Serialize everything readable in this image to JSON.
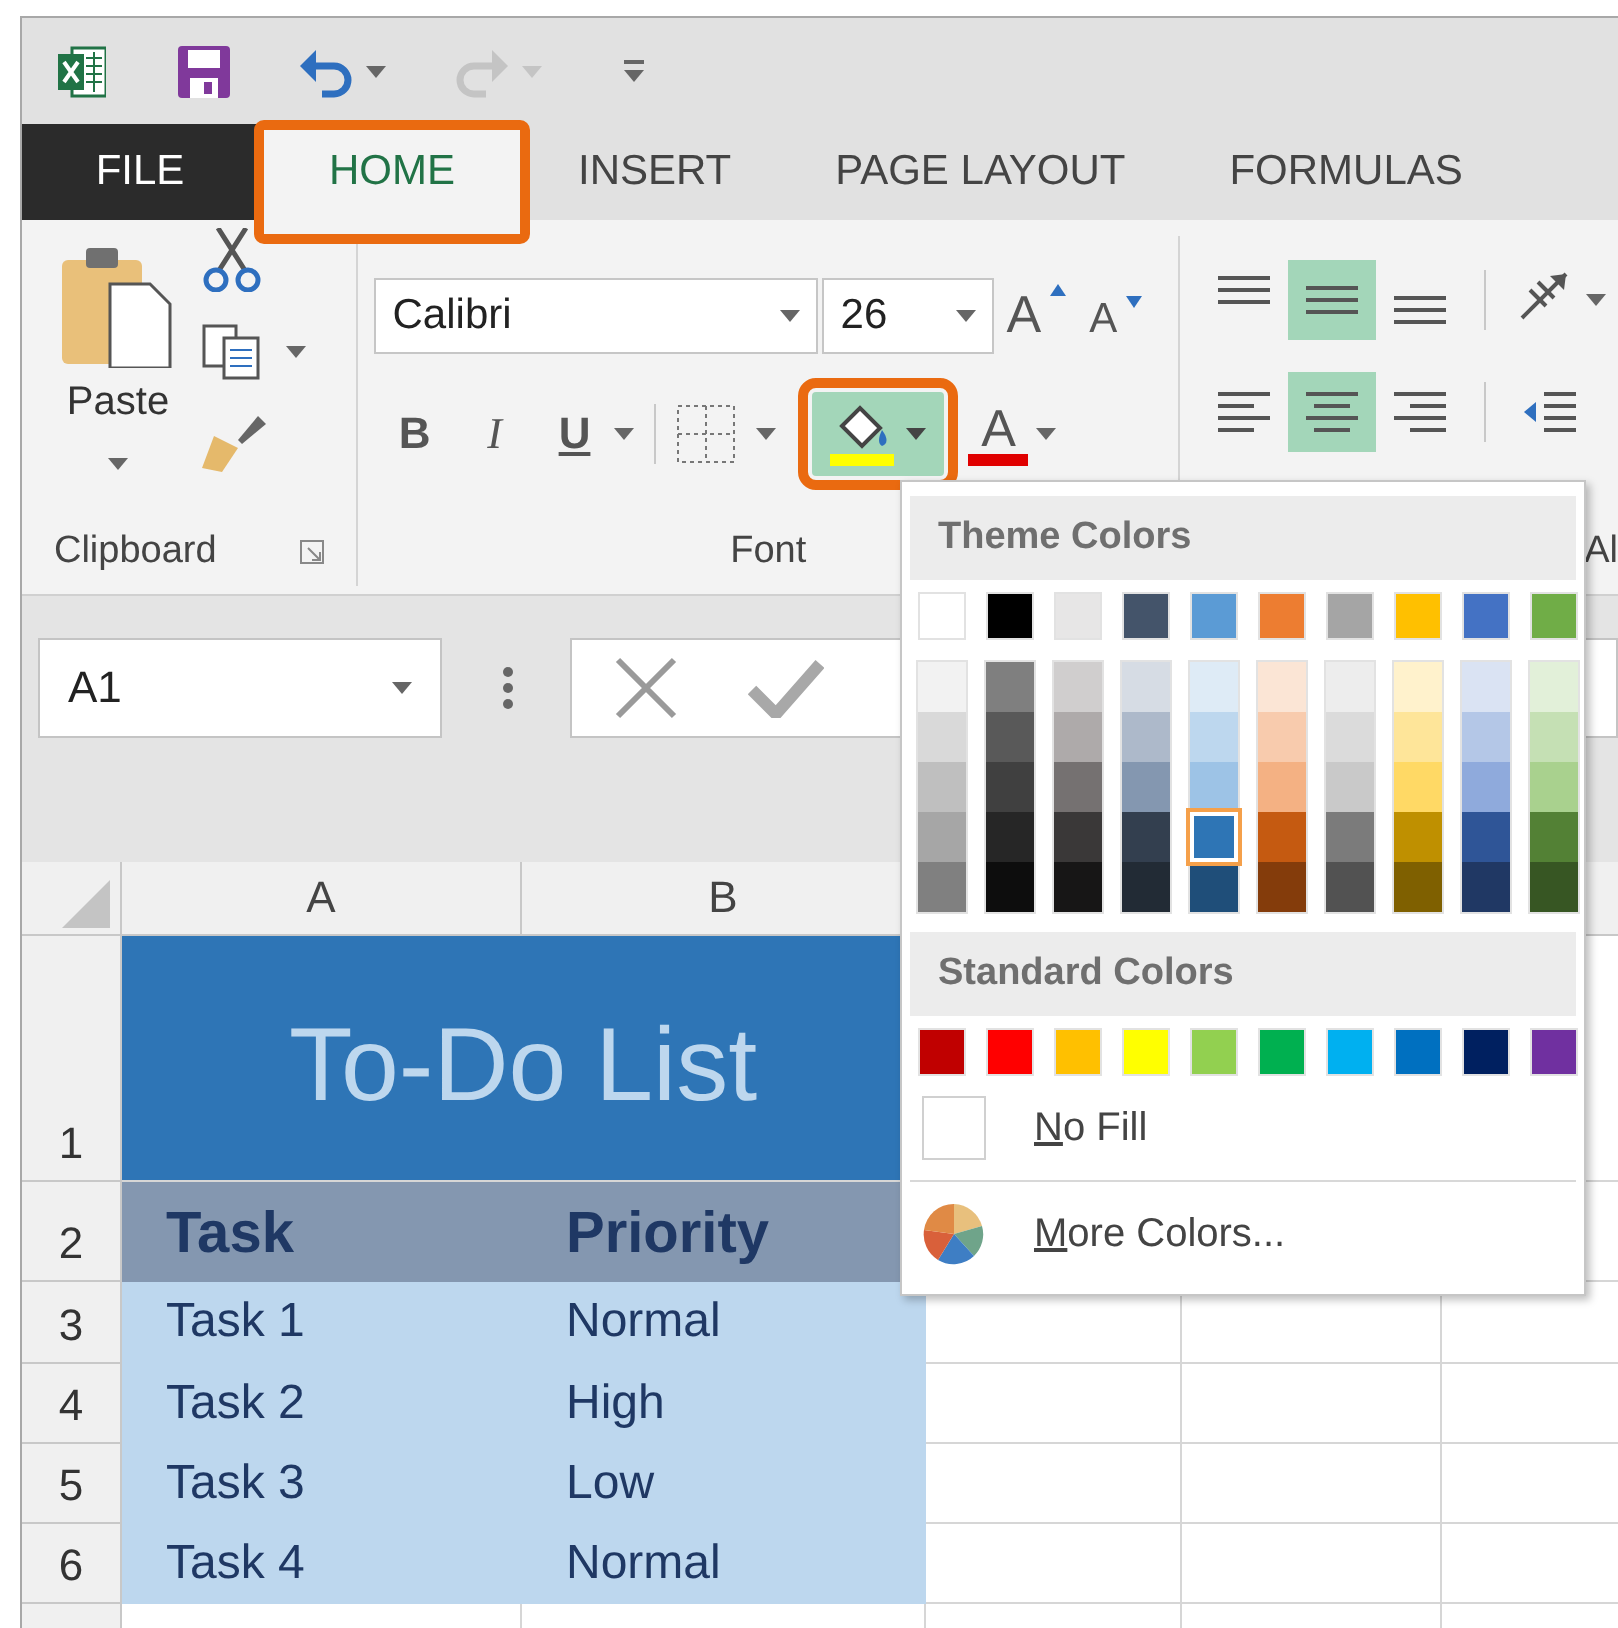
{
  "quick_access": [
    {
      "kind": "logo"
    },
    {
      "kind": "save"
    },
    {
      "kind": "undo",
      "disabled": false
    },
    {
      "kind": "redo",
      "disabled": true
    },
    {
      "kind": "customize"
    }
  ],
  "tabs": [
    {
      "kind": "file",
      "label": "FILE",
      "selected": false,
      "callout": false
    },
    {
      "kind": "tab",
      "label": "HOME",
      "selected": true,
      "callout": true
    },
    {
      "kind": "tab",
      "label": "INSERT",
      "selected": false,
      "callout": false
    },
    {
      "kind": "tab",
      "label": "PAGE LAYOUT",
      "selected": false,
      "callout": false
    },
    {
      "kind": "tab",
      "label": "FORMULAS",
      "selected": false,
      "callout": false
    }
  ],
  "ribbon": {
    "clipboard": {
      "paste_label": "Paste",
      "group_label": "Clipboard"
    },
    "font": {
      "group_label": "Font",
      "font_name": "Calibri",
      "font_size": "26",
      "size_buttons": [
        {
          "kind": "grow",
          "label": "A"
        },
        {
          "kind": "shrink",
          "label": "A"
        }
      ],
      "style_buttons": [
        {
          "kind": "bold",
          "label": "B"
        },
        {
          "kind": "italic",
          "label": "I"
        },
        {
          "kind": "underline",
          "label": "U"
        }
      ],
      "fill_button": {
        "open": true,
        "callout": true
      },
      "font_color_button": {
        "label": "A"
      }
    },
    "alignment": {
      "group_label": "Al",
      "buttons": [
        {
          "kind": "top",
          "on": false
        },
        {
          "kind": "middle",
          "on": true
        },
        {
          "kind": "bottom",
          "on": false
        },
        {
          "kind": "orientation",
          "on": false
        },
        {
          "kind": "left",
          "on": false
        },
        {
          "kind": "center",
          "on": true
        },
        {
          "kind": "right",
          "on": false
        },
        {
          "kind": "outdent",
          "on": false
        }
      ]
    }
  },
  "name_box": {
    "value": "A1"
  },
  "sheet": {
    "columns": [
      "A",
      "B"
    ],
    "rows": [
      {
        "number": "1",
        "kind": "title",
        "cells": [
          "To-Do List"
        ]
      },
      {
        "number": "2",
        "kind": "header",
        "cells": [
          "Task",
          "Priority"
        ]
      },
      {
        "number": "3",
        "kind": "data",
        "cells": [
          "Task 1",
          "Normal"
        ]
      },
      {
        "number": "4",
        "kind": "data",
        "cells": [
          "Task 2",
          "High"
        ]
      },
      {
        "number": "5",
        "kind": "data",
        "cells": [
          "Task 3",
          "Low"
        ]
      },
      {
        "number": "6",
        "kind": "data",
        "cells": [
          "Task 4",
          "Normal"
        ]
      }
    ]
  },
  "color_menu": {
    "theme_title": "Theme Colors",
    "theme_colors": [
      {
        "color": "#ffffff",
        "selected": false
      },
      {
        "color": "#000000",
        "selected": false
      },
      {
        "color": "#e7e6e6",
        "selected": false
      },
      {
        "color": "#44546a",
        "selected": false
      },
      {
        "color": "#5b9bd5",
        "selected": false
      },
      {
        "color": "#ed7d31",
        "selected": false
      },
      {
        "color": "#a5a5a5",
        "selected": false
      },
      {
        "color": "#ffc000",
        "selected": false
      },
      {
        "color": "#4472c4",
        "selected": false
      },
      {
        "color": "#70ad47",
        "selected": false
      }
    ],
    "theme_shades": [
      [
        {
          "color": "#f2f2f2",
          "selected": false
        },
        {
          "color": "#d9d9d9",
          "selected": false
        },
        {
          "color": "#bfbfbf",
          "selected": false
        },
        {
          "color": "#a6a6a6",
          "selected": false
        },
        {
          "color": "#808080",
          "selected": false
        }
      ],
      [
        {
          "color": "#7f7f7f",
          "selected": false
        },
        {
          "color": "#595959",
          "selected": false
        },
        {
          "color": "#404040",
          "selected": false
        },
        {
          "color": "#262626",
          "selected": false
        },
        {
          "color": "#0d0d0d",
          "selected": false
        }
      ],
      [
        {
          "color": "#d0cece",
          "selected": false
        },
        {
          "color": "#aeaaaa",
          "selected": false
        },
        {
          "color": "#757171",
          "selected": false
        },
        {
          "color": "#3a3838",
          "selected": false
        },
        {
          "color": "#171616",
          "selected": false
        }
      ],
      [
        {
          "color": "#d6dce4",
          "selected": false
        },
        {
          "color": "#adb9ca",
          "selected": false
        },
        {
          "color": "#8497b0",
          "selected": false
        },
        {
          "color": "#333f4f",
          "selected": false
        },
        {
          "color": "#222b35",
          "selected": false
        }
      ],
      [
        {
          "color": "#deebf6",
          "selected": false
        },
        {
          "color": "#bdd7ee",
          "selected": false
        },
        {
          "color": "#9dc3e6",
          "selected": false
        },
        {
          "color": "#2e75b5",
          "selected": true
        },
        {
          "color": "#1f4e79",
          "selected": false
        }
      ],
      [
        {
          "color": "#fbe5d5",
          "selected": false
        },
        {
          "color": "#f8cbad",
          "selected": false
        },
        {
          "color": "#f4b183",
          "selected": false
        },
        {
          "color": "#c55a11",
          "selected": false
        },
        {
          "color": "#843c0b",
          "selected": false
        }
      ],
      [
        {
          "color": "#ededed",
          "selected": false
        },
        {
          "color": "#dbdbdb",
          "selected": false
        },
        {
          "color": "#c9c9c9",
          "selected": false
        },
        {
          "color": "#7b7b7b",
          "selected": false
        },
        {
          "color": "#525252",
          "selected": false
        }
      ],
      [
        {
          "color": "#fff2cc",
          "selected": false
        },
        {
          "color": "#fee599",
          "selected": false
        },
        {
          "color": "#ffd965",
          "selected": false
        },
        {
          "color": "#bf9000",
          "selected": false
        },
        {
          "color": "#7f6000",
          "selected": false
        }
      ],
      [
        {
          "color": "#dae3f3",
          "selected": false
        },
        {
          "color": "#b4c7e7",
          "selected": false
        },
        {
          "color": "#8faadc",
          "selected": false
        },
        {
          "color": "#2f5597",
          "selected": false
        },
        {
          "color": "#203864",
          "selected": false
        }
      ],
      [
        {
          "color": "#e2f0d9",
          "selected": false
        },
        {
          "color": "#c5e0b4",
          "selected": false
        },
        {
          "color": "#a9d18e",
          "selected": false
        },
        {
          "color": "#538135",
          "selected": false
        },
        {
          "color": "#375623",
          "selected": false
        }
      ]
    ],
    "standard_title": "Standard Colors",
    "standard_colors": [
      {
        "color": "#c00000",
        "selected": false
      },
      {
        "color": "#ff0000",
        "selected": false
      },
      {
        "color": "#ffc000",
        "selected": false
      },
      {
        "color": "#ffff00",
        "selected": false
      },
      {
        "color": "#92d050",
        "selected": false
      },
      {
        "color": "#00b050",
        "selected": false
      },
      {
        "color": "#00b0f0",
        "selected": false
      },
      {
        "color": "#0070c0",
        "selected": false
      },
      {
        "color": "#002060",
        "selected": false
      },
      {
        "color": "#7030a0",
        "selected": false
      }
    ],
    "no_fill": "No Fill",
    "more_colors": "More Colors..."
  }
}
